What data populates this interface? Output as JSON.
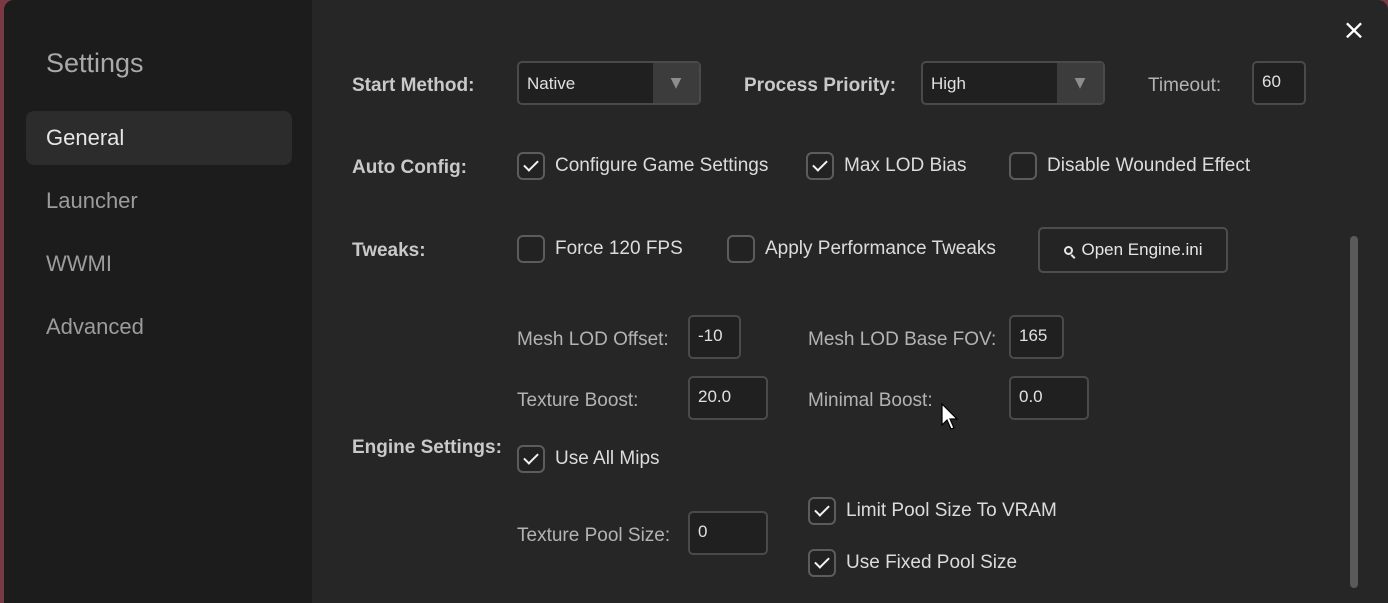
{
  "sidebar": {
    "title": "Settings",
    "items": [
      {
        "label": "General",
        "active": true
      },
      {
        "label": "Launcher",
        "active": false
      },
      {
        "label": "WWMI",
        "active": false
      },
      {
        "label": "Advanced",
        "active": false
      }
    ]
  },
  "close_icon": "×",
  "start_method": {
    "label": "Start Method:",
    "value": "Native"
  },
  "process_priority": {
    "label": "Process Priority:",
    "value": "High"
  },
  "timeout": {
    "label": "Timeout:",
    "value": "60"
  },
  "auto_config": {
    "label": "Auto Config:",
    "configure_game_settings": {
      "label": "Configure Game Settings",
      "checked": true
    },
    "max_lod_bias": {
      "label": "Max LOD Bias",
      "checked": true
    },
    "disable_wounded_effect": {
      "label": "Disable Wounded Effect",
      "checked": false
    }
  },
  "tweaks": {
    "label": "Tweaks:",
    "force_120_fps": {
      "label": "Force 120 FPS",
      "checked": false
    },
    "apply_performance_tweaks": {
      "label": "Apply Performance Tweaks",
      "checked": false
    },
    "open_engine_ini": {
      "label": "Open Engine.ini"
    }
  },
  "engine_settings": {
    "label": "Engine Settings:",
    "mesh_lod_offset": {
      "label": "Mesh LOD Offset:",
      "value": "-10"
    },
    "mesh_lod_base_fov": {
      "label": "Mesh LOD Base FOV:",
      "value": "165"
    },
    "texture_boost": {
      "label": "Texture Boost:",
      "value": "20.0"
    },
    "minimal_boost": {
      "label": "Minimal Boost:",
      "value": "0.0"
    },
    "use_all_mips": {
      "label": "Use All Mips",
      "checked": true
    },
    "texture_pool_size": {
      "label": "Texture Pool Size:",
      "value": "0"
    },
    "limit_pool_size_to_vram": {
      "label": "Limit Pool Size To VRAM",
      "checked": true
    },
    "use_fixed_pool_size": {
      "label": "Use Fixed Pool Size",
      "checked": true
    }
  },
  "icons": {
    "dropdown_arrow": "chevron-down-icon",
    "checkbox_check": "checkmark-icon",
    "open_engine_ini": "magnifier-icon",
    "close": "close-icon",
    "pointer": "mouse-cursor-icon"
  }
}
